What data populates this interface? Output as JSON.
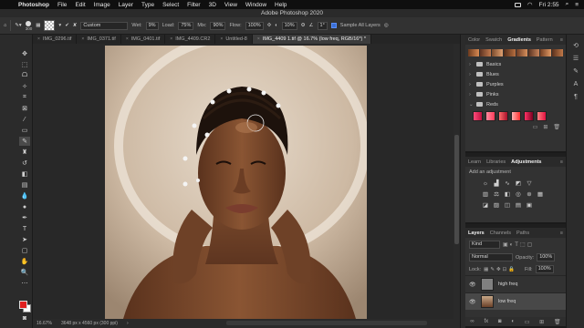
{
  "menubar": {
    "app_name": "Photoshop",
    "items": [
      "File",
      "Edit",
      "Image",
      "Layer",
      "Type",
      "Select",
      "Filter",
      "3D",
      "View",
      "Window",
      "Help"
    ],
    "clock": "Fri 2:55"
  },
  "titlebar": {
    "title": "Adobe Photoshop 2020"
  },
  "options": {
    "brush_size": "300",
    "preset": "Custom",
    "wet_label": "Wet:",
    "wet_value": "9%",
    "load_label": "Load:",
    "load_value": "75%",
    "mix_label": "Mix:",
    "mix_value": "90%",
    "flow_label": "Flow:",
    "flow_value": "100%",
    "smoothing_value": "10%",
    "angle_value": "1°",
    "sample_all_label": "Sample All Layers"
  },
  "tabs": [
    {
      "label": "IMG_0296.tif",
      "active": false
    },
    {
      "label": "IMG_0371.tif",
      "active": false
    },
    {
      "label": "IMG_0401.tif",
      "active": false
    },
    {
      "label": "IMG_4409.CR2",
      "active": false
    },
    {
      "label": "Untitled-8",
      "active": false
    },
    {
      "label": "IMG_4409 1.tif @ 16.7% (low freq, RGB/16*) *",
      "active": true
    }
  ],
  "status": {
    "zoom": "16.67%",
    "doc_size": "3648 px x 4560 px (300 ppi)"
  },
  "colors": {
    "foreground": "#e02020",
    "background": "#ffffff"
  },
  "gradients_panel": {
    "tabs": [
      "Color",
      "Swatch",
      "Gradients",
      "Pattern"
    ],
    "active_tab": "Gradients",
    "folders": [
      "Basics",
      "Blues",
      "Purples",
      "Pinks",
      "Reds"
    ]
  },
  "adjustments_panel": {
    "tabs": [
      "Learn",
      "Libraries",
      "Adjustments"
    ],
    "active_tab": "Adjustments",
    "add_label": "Add an adjustment"
  },
  "layers_panel": {
    "tabs": [
      "Layers",
      "Channels",
      "Paths"
    ],
    "active_tab": "Layers",
    "filter_kind": "Kind",
    "blend_mode": "Normal",
    "opacity_label": "Opacity:",
    "opacity_value": "100%",
    "lock_label": "Lock:",
    "fill_label": "Fill:",
    "fill_value": "100%",
    "layers": [
      {
        "name": "high freq",
        "selected": false
      },
      {
        "name": "low freq",
        "selected": true
      }
    ]
  }
}
